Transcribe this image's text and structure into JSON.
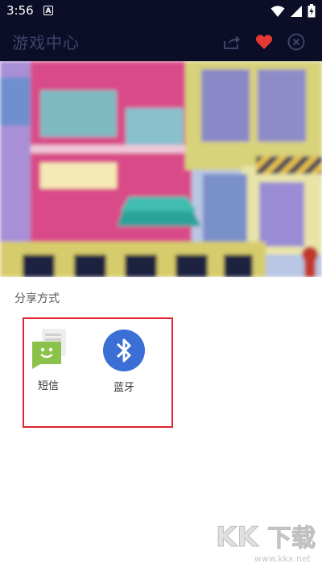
{
  "status_bar": {
    "time": "3:56",
    "notification_letter": "A"
  },
  "header": {
    "title": "游戏中心"
  },
  "share_sheet": {
    "title": "分享方式",
    "options": [
      {
        "label": "短信",
        "icon": "sms-icon",
        "color": "#8bc34a"
      },
      {
        "label": "蓝牙",
        "icon": "bluetooth-icon",
        "color": "#3b6fd6"
      }
    ]
  },
  "watermark": {
    "logo": "KK下载",
    "url": "www.kkx.net"
  },
  "colors": {
    "header_bg": "#0b0e26",
    "favorite": "#e53935",
    "highlight": "#e0242d"
  }
}
